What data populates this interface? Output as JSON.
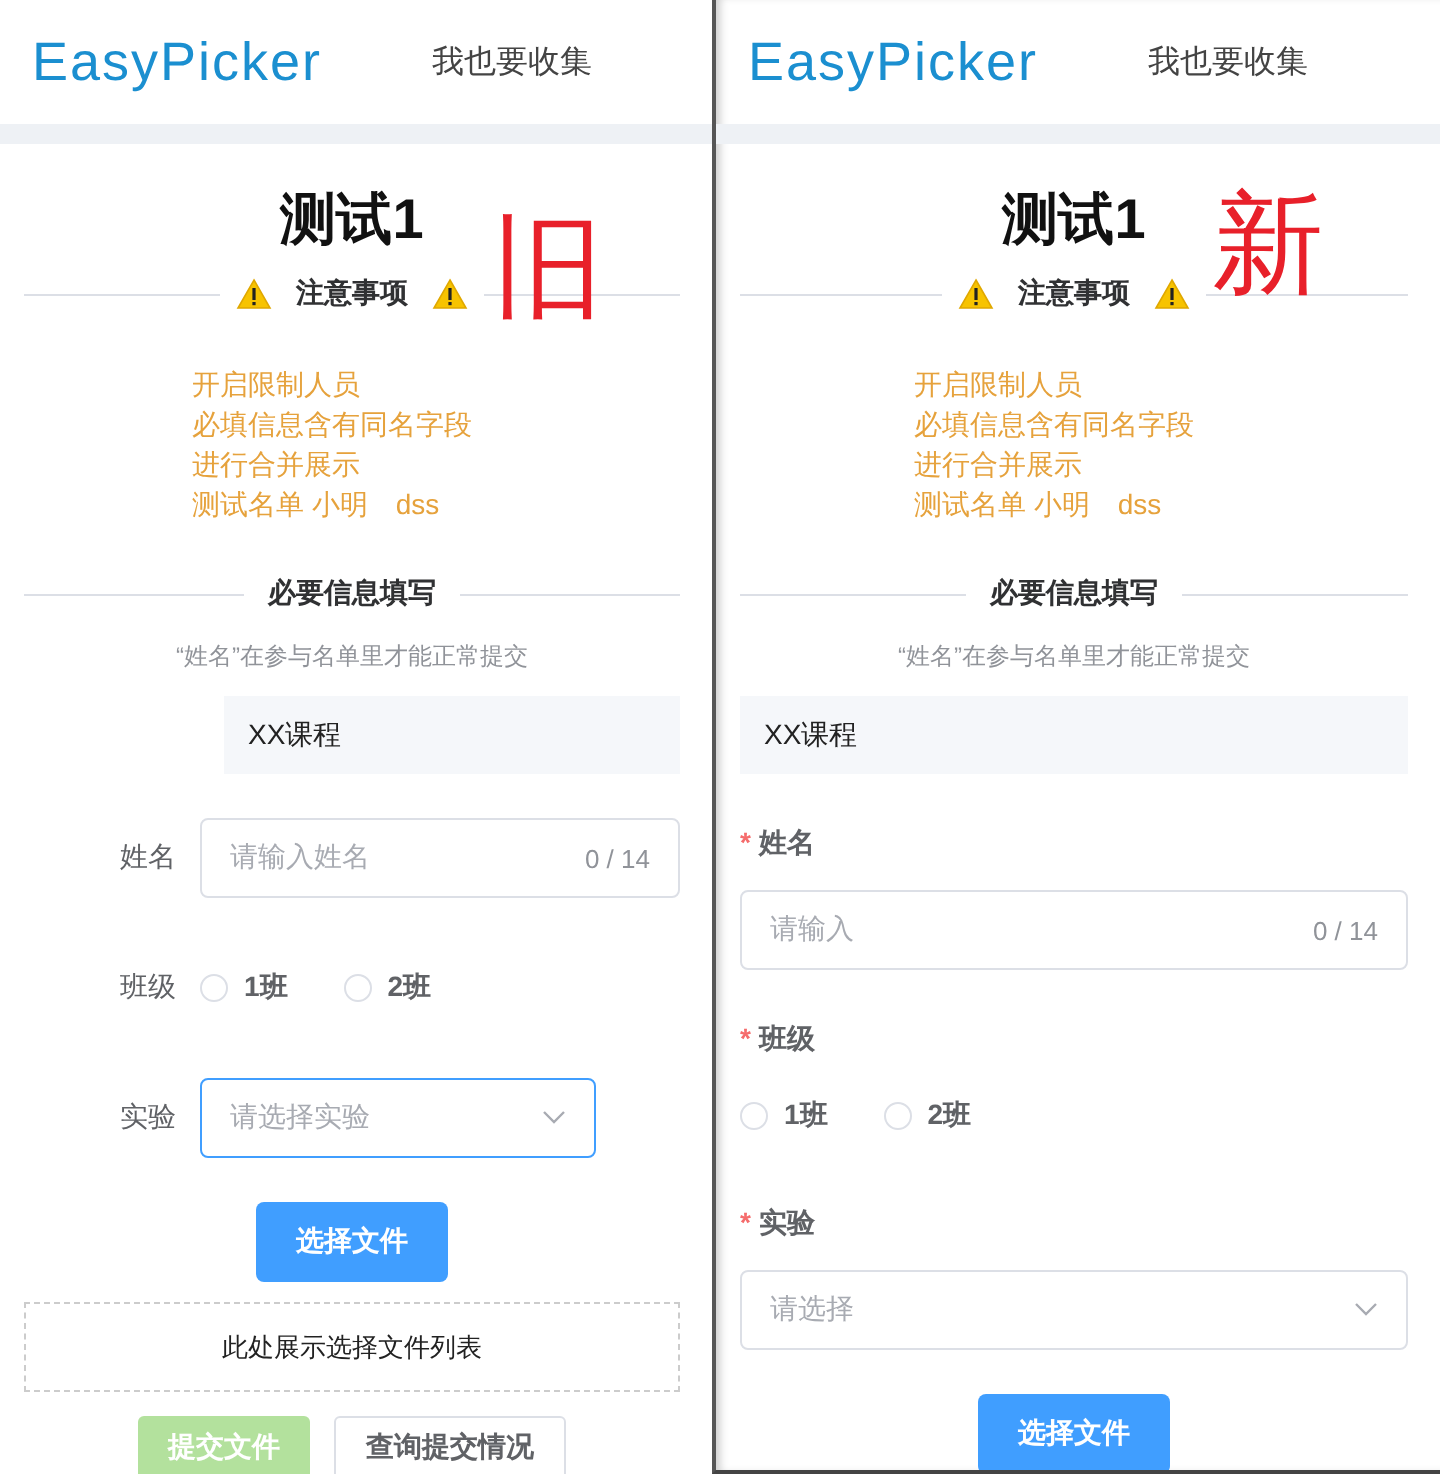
{
  "panels": [
    {
      "header": {
        "logo": "EasyPicker",
        "link": "我也要收集"
      },
      "annotation": "旧",
      "title": "测试1",
      "notice_heading": "注意事项",
      "notices": [
        "开启限制人员",
        "必填信息含有同名字段",
        "进行合并展示",
        "测试名单 小明　dss"
      ],
      "info_heading": "必要信息填写",
      "hint": "“姓名”在参与名单里才能正常提交",
      "course": "XX课程",
      "labels_above": false,
      "fields": [
        {
          "kind": "text",
          "label": "姓名",
          "placeholder": "请输入姓名",
          "counter": "0 / 14"
        },
        {
          "kind": "radio",
          "label": "班级",
          "options": [
            {
              "label": "1班",
              "selected": false
            },
            {
              "label": "2班",
              "selected": false
            }
          ]
        },
        {
          "kind": "select",
          "label": "实验",
          "placeholder": "请选择实验",
          "focused": true
        }
      ],
      "choose_button": "选择文件",
      "file_list_placeholder": "此处展示选择文件列表",
      "actions": [
        {
          "label": "提交文件",
          "kind": "primary",
          "disabled": true
        },
        {
          "label": "查询提交情况",
          "kind": "default",
          "disabled": false
        }
      ]
    },
    {
      "header": {
        "logo": "EasyPicker",
        "link": "我也要收集"
      },
      "annotation": "新",
      "title": "测试1",
      "notice_heading": "注意事项",
      "notices": [
        "开启限制人员",
        "必填信息含有同名字段",
        "进行合并展示",
        "测试名单 小明　dss"
      ],
      "info_heading": "必要信息填写",
      "hint": "“姓名”在参与名单里才能正常提交",
      "course": "XX课程",
      "labels_above": true,
      "fields": [
        {
          "kind": "text",
          "label": "姓名",
          "required_mark": "*",
          "placeholder": "请输入",
          "counter": "0 / 14"
        },
        {
          "kind": "radio",
          "label": "班级",
          "required_mark": "*",
          "options": [
            {
              "label": "1班",
              "selected": false
            },
            {
              "label": "2班",
              "selected": false
            }
          ]
        },
        {
          "kind": "select",
          "label": "实验",
          "required_mark": "*",
          "placeholder": "请选择",
          "focused": false
        }
      ],
      "choose_button": "选择文件"
    }
  ]
}
